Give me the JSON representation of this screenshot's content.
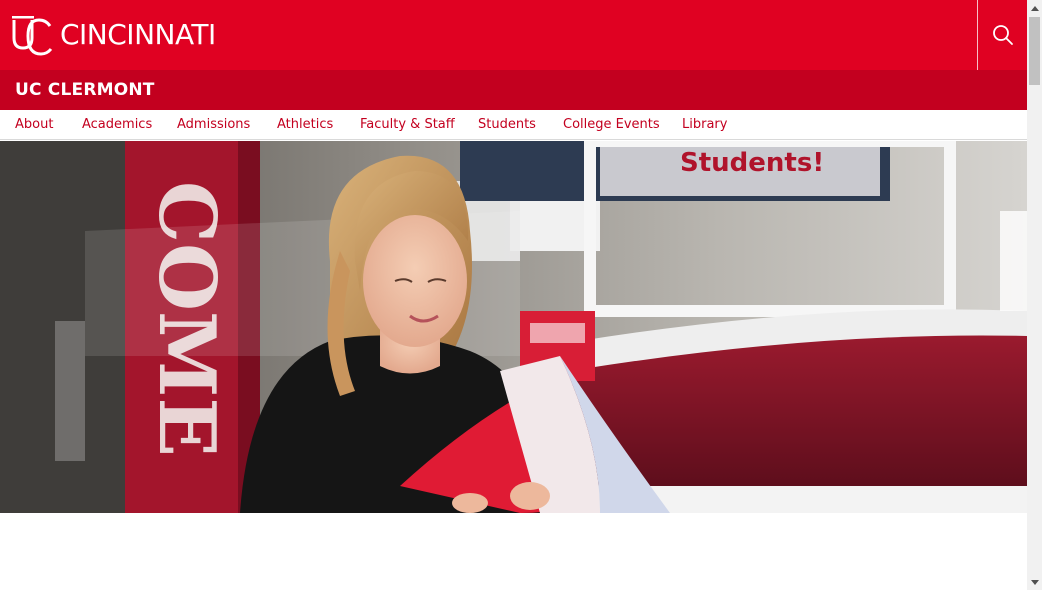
{
  "header": {
    "logo_text": "CINCINNATI",
    "logo_mark": "UC"
  },
  "college": {
    "title": "UC CLERMONT"
  },
  "nav": {
    "items": [
      {
        "label": "About"
      },
      {
        "label": "Academics"
      },
      {
        "label": "Admissions"
      },
      {
        "label": "Athletics"
      },
      {
        "label": "Faculty & Staff"
      },
      {
        "label": "Students"
      },
      {
        "label": "College Events"
      },
      {
        "label": "Library"
      }
    ]
  },
  "hero": {
    "banner_text": "COME",
    "screen_text": "Students!",
    "icons": [
      "student-reading-photo"
    ]
  },
  "colors": {
    "brand_red": "#e00122",
    "college_bar": "#c3001f",
    "nav_link": "#c3001f"
  },
  "icons": [
    "search-icon",
    "uc-logo-icon",
    "scroll-up-icon",
    "scroll-down-icon"
  ]
}
